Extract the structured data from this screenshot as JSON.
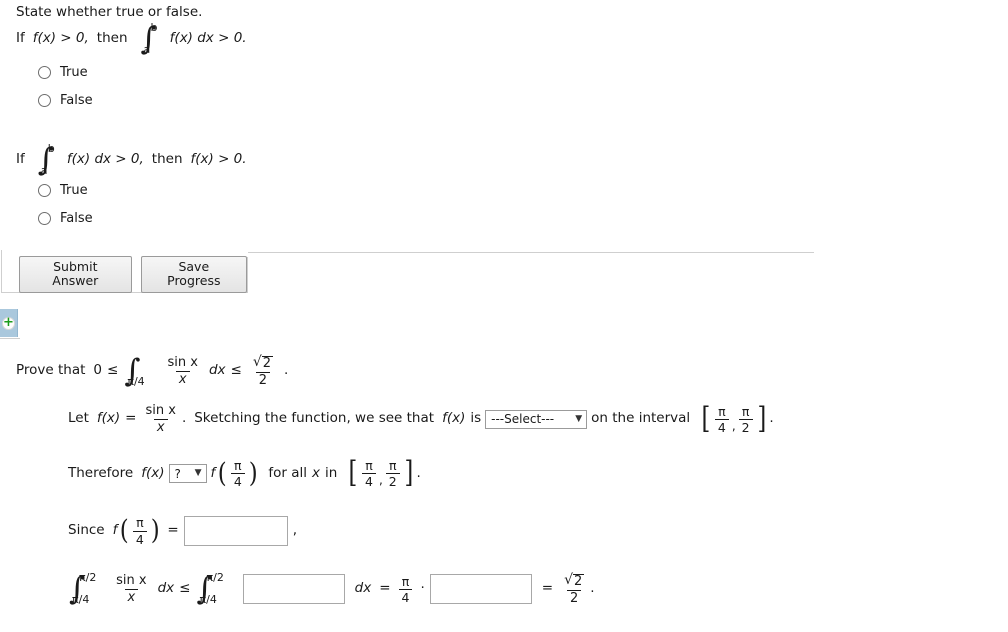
{
  "question1": {
    "prompt": "State whether true or false.",
    "statement": {
      "if_label": "If",
      "condition": "f(x) > 0,",
      "then_label": "then",
      "integral_upper": "b",
      "integral_lower": "a",
      "integrand": "f(x) dx > 0."
    },
    "options": [
      {
        "label": "True",
        "selected": false
      },
      {
        "label": "False",
        "selected": false
      }
    ]
  },
  "question2": {
    "statement": {
      "if_label": "If",
      "integral_upper": "b",
      "integral_lower": "a",
      "integrand": "f(x) dx > 0,",
      "then_label": "then",
      "conclusion": "f(x) > 0."
    },
    "options": [
      {
        "label": "True",
        "selected": false
      },
      {
        "label": "False",
        "selected": false
      }
    ]
  },
  "toolbar": {
    "submit_label": "Submit Answer",
    "save_label": "Save Progress"
  },
  "expand_widget": {
    "glyph": "+"
  },
  "question3": {
    "prove_label": "Prove that",
    "lower_bound": "0",
    "rel1": "≤",
    "integral_lower": "π/4",
    "integral_upper": "",
    "integrand_num": "sin x",
    "integrand_den": "x",
    "dx": "dx",
    "rel2": "≤",
    "upper_num_radical": "2",
    "upper_den": "2",
    "period": ".",
    "step1": {
      "let_label": "Let",
      "fx": "f(x)",
      "equals": "=",
      "num": "sin x",
      "den": "x",
      "period": ".",
      "sketch_text": "Sketching the function, we see that",
      "fx2": "f(x)",
      "is_label": "is",
      "select_value": "---Select---",
      "interval_label": "on the interval",
      "interval_left_num": "π",
      "interval_left_den": "4",
      "interval_right_num": "π",
      "interval_right_den": "2",
      "end_period": "."
    },
    "step2": {
      "therefore_label": "Therefore",
      "fx": "f(x)",
      "select_value": "?",
      "f_label": "f",
      "arg_num": "π",
      "arg_den": "4",
      "forall_text": "for all",
      "x_var": "x",
      "in_label": "in",
      "interval_left_num": "π",
      "interval_left_den": "4",
      "interval_right_num": "π",
      "interval_right_den": "2",
      "end_period": "."
    },
    "step3": {
      "since_label": "Since",
      "f_label": "f",
      "arg_num": "π",
      "arg_den": "4",
      "equals": "=",
      "input_value": "",
      "input_placeholder": "",
      "comma": ","
    },
    "step4": {
      "int1_upper": "π/2",
      "int1_lower": "π/4",
      "num": "sin x",
      "den": "x",
      "dx1": "dx",
      "rel": "≤",
      "int2_upper": "π/2",
      "int2_lower": "π/4",
      "input1_value": "",
      "dx2": "dx",
      "equals1": "=",
      "coef_num": "π",
      "coef_den": "4",
      "dot": "·",
      "input2_value": "",
      "equals2": "=",
      "result_radicand": "2",
      "result_den": "2",
      "end_period": "."
    }
  },
  "colors": {
    "accent": "#aac8dd",
    "plus": "#1b9c1b",
    "rule": "#cfcfcf"
  }
}
